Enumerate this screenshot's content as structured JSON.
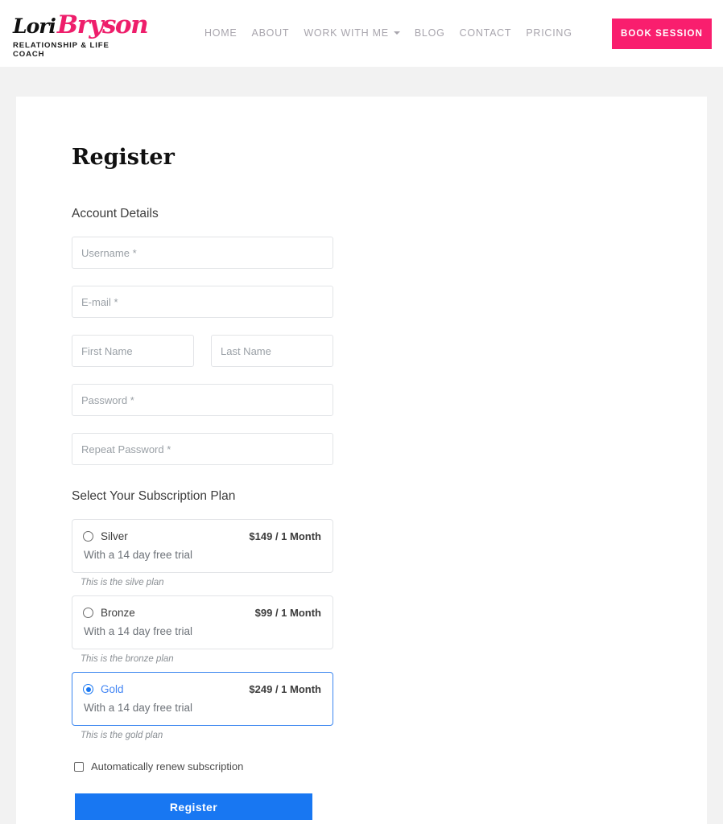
{
  "header": {
    "logo": {
      "first_name": "Lori",
      "last_name": "Bryson",
      "tagline": "RELATIONSHIP & LIFE COACH",
      "accent_color": "#ee1e6b"
    },
    "nav": [
      {
        "label": "HOME",
        "has_dropdown": false
      },
      {
        "label": "ABOUT",
        "has_dropdown": false
      },
      {
        "label": "WORK WITH ME",
        "has_dropdown": true
      },
      {
        "label": "BLOG",
        "has_dropdown": false
      },
      {
        "label": "CONTACT",
        "has_dropdown": false
      },
      {
        "label": "PRICING",
        "has_dropdown": false
      }
    ],
    "cta": {
      "label": "BOOK SESSION",
      "background": "#f91e6e",
      "color": "#ffffff"
    }
  },
  "main": {
    "title": "Register",
    "account_section_label": "Account Details",
    "fields": {
      "username_placeholder": "Username *",
      "email_placeholder": "E-mail *",
      "first_name_placeholder": "First Name",
      "last_name_placeholder": "Last Name",
      "password_placeholder": "Password *",
      "repeat_password_placeholder": "Repeat Password *",
      "username_value": "",
      "email_value": "",
      "first_name_value": "",
      "last_name_value": "",
      "password_value": "",
      "repeat_password_value": ""
    },
    "plans_section_label": "Select Your Subscription Plan",
    "plans": [
      {
        "name": "Silver",
        "price": "$149 / 1 Month",
        "trial": "With a 14 day free trial",
        "note": "This is the silve plan",
        "selected": false
      },
      {
        "name": "Bronze",
        "price": "$99 / 1 Month",
        "trial": "With a 14 day free trial",
        "note": "This is the bronze plan",
        "selected": false
      },
      {
        "name": "Gold",
        "price": "$249 / 1 Month",
        "trial": "With a 14 day free trial",
        "note": "This is the gold plan",
        "selected": true
      }
    ],
    "auto_renew_label": "Automatically renew subscription",
    "auto_renew_checked": false,
    "submit_label": "Register",
    "submit_color": "#1877f2",
    "selected_plan_color": "#1877f2"
  }
}
